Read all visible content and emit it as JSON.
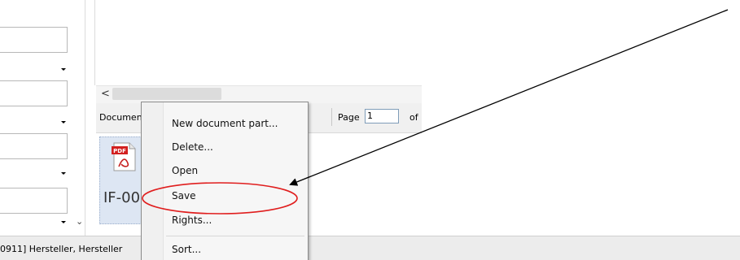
{
  "colors": {
    "annotation": "#e01e1e",
    "arrow": "#000000",
    "menu_bg": "#f6f6f6",
    "selection_tile": "#dde6f3"
  },
  "toolbar": {
    "documents_label": "Documents",
    "page_label": "Page",
    "page_value": "1",
    "of_label": "of"
  },
  "document": {
    "icon": "pdf-icon",
    "icon_text": "PDF",
    "name": "IF-00"
  },
  "context_menu": {
    "items": [
      {
        "label": "New document part..."
      },
      {
        "label": "Delete..."
      },
      {
        "label": "Open"
      },
      {
        "label": "Save"
      },
      {
        "label": "Rights..."
      },
      {
        "label": "Sort..."
      }
    ]
  },
  "status_bar": {
    "text": "0911] Hersteller, Hersteller"
  }
}
